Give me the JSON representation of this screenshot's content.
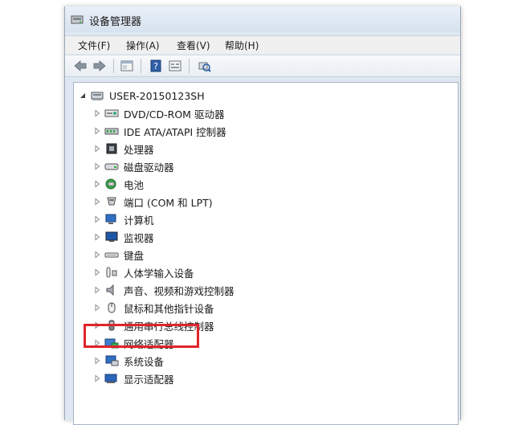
{
  "window": {
    "title": "设备管理器"
  },
  "menu": [
    "文件(F)",
    "操作(A)",
    "查看(V)",
    "帮助(H)"
  ],
  "toolbar": {
    "buttons": [
      "back-icon",
      "forward-icon",
      "show-hide-icon",
      "help-icon",
      "properties-icon",
      "scan-hardware-icon"
    ]
  },
  "tree": {
    "root": "USER-20150123SH",
    "items": [
      {
        "label": "DVD/CD-ROM 驱动器",
        "icon": "dvd-drive-icon"
      },
      {
        "label": "IDE ATA/ATAPI 控制器",
        "icon": "ide-controller-icon"
      },
      {
        "label": "处理器",
        "icon": "processor-icon"
      },
      {
        "label": "磁盘驱动器",
        "icon": "disk-drive-icon"
      },
      {
        "label": "电池",
        "icon": "battery-icon"
      },
      {
        "label": "端口 (COM 和 LPT)",
        "icon": "port-icon"
      },
      {
        "label": "计算机",
        "icon": "computer-icon"
      },
      {
        "label": "监视器",
        "icon": "monitor-icon"
      },
      {
        "label": "键盘",
        "icon": "keyboard-icon"
      },
      {
        "label": "人体学输入设备",
        "icon": "hid-icon"
      },
      {
        "label": "声音、视频和游戏控制器",
        "icon": "sound-icon"
      },
      {
        "label": "鼠标和其他指针设备",
        "icon": "mouse-icon"
      },
      {
        "label": "通用串行总线控制器",
        "icon": "usb-icon"
      },
      {
        "label": "网络适配器",
        "icon": "network-adapter-icon"
      },
      {
        "label": "系统设备",
        "icon": "system-device-icon"
      },
      {
        "label": "显示适配器",
        "icon": "display-adapter-icon"
      }
    ]
  },
  "colors": {
    "highlight": "#e0242b"
  }
}
